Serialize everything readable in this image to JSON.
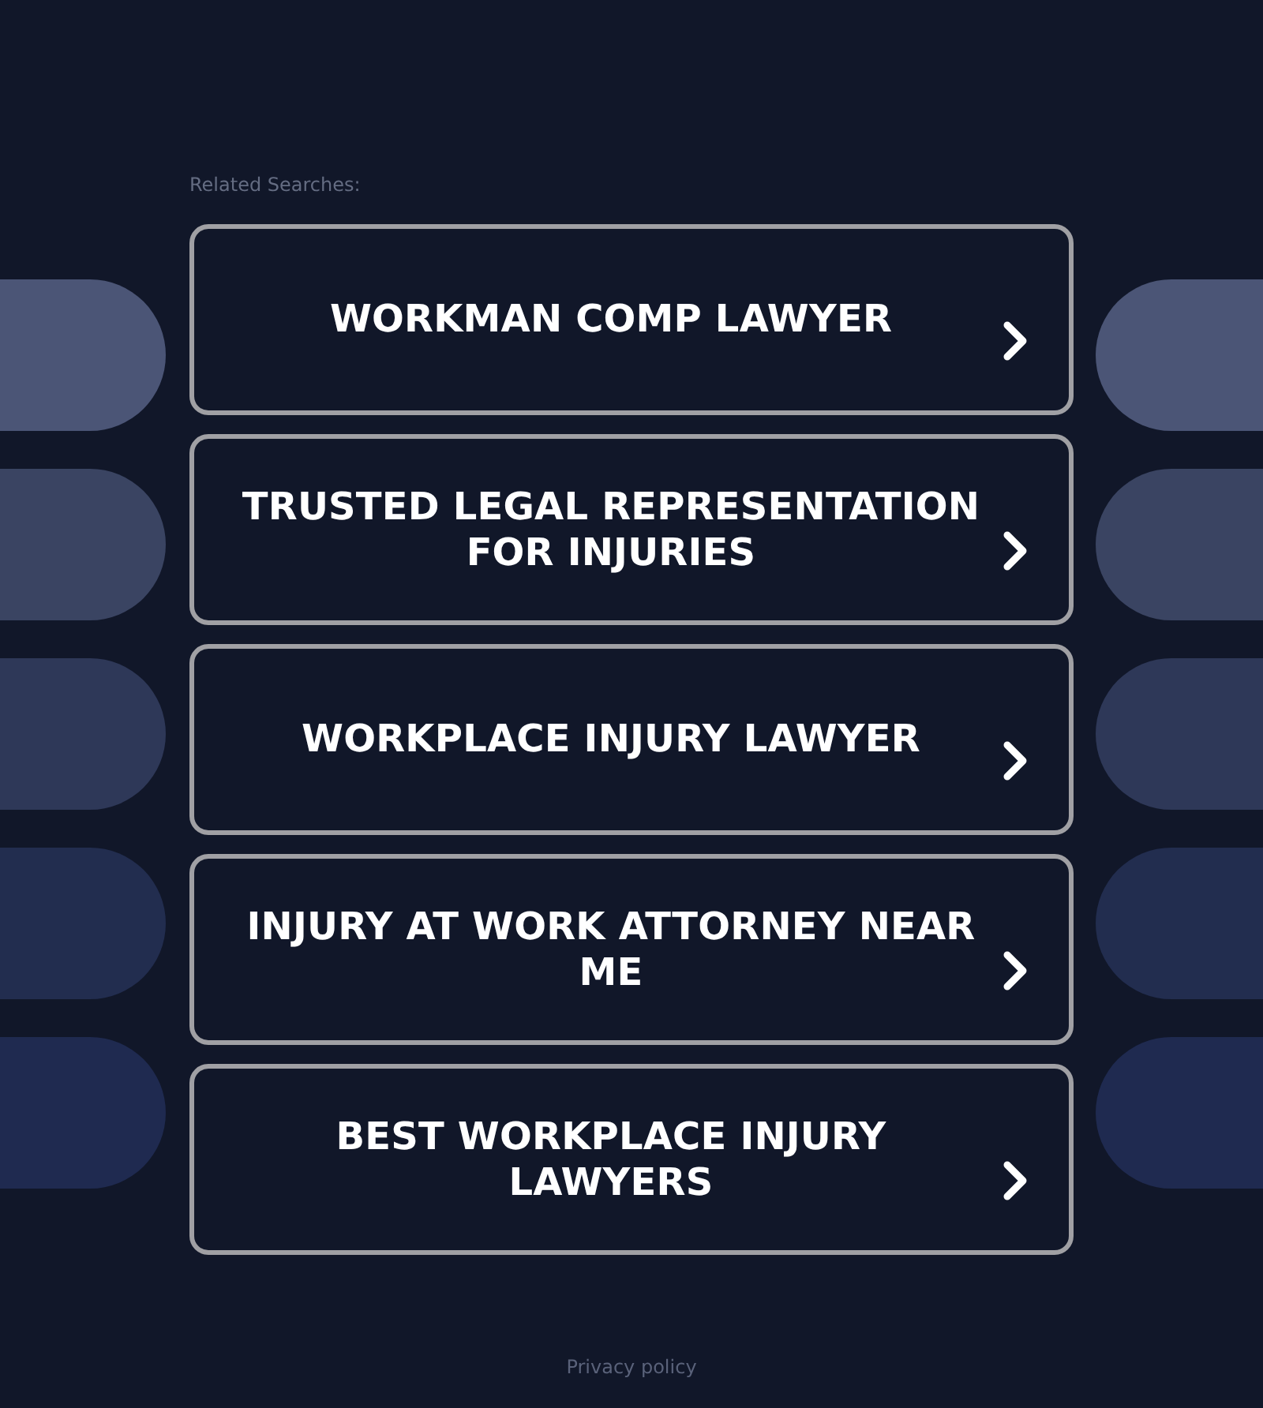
{
  "related_searches": {
    "heading": "Related Searches:",
    "links": [
      {
        "label": "WORKMAN COMP LAWYER"
      },
      {
        "label": "TRUSTED LEGAL REPRESENTATION FOR INJURIES"
      },
      {
        "label": "WORKPLACE INJURY LAWYER"
      },
      {
        "label": "INJURY AT WORK ATTORNEY NEAR ME"
      },
      {
        "label": "BEST WORKPLACE INJURY LAWYERS"
      }
    ]
  },
  "footer": {
    "privacy_link": "Privacy policy"
  }
}
